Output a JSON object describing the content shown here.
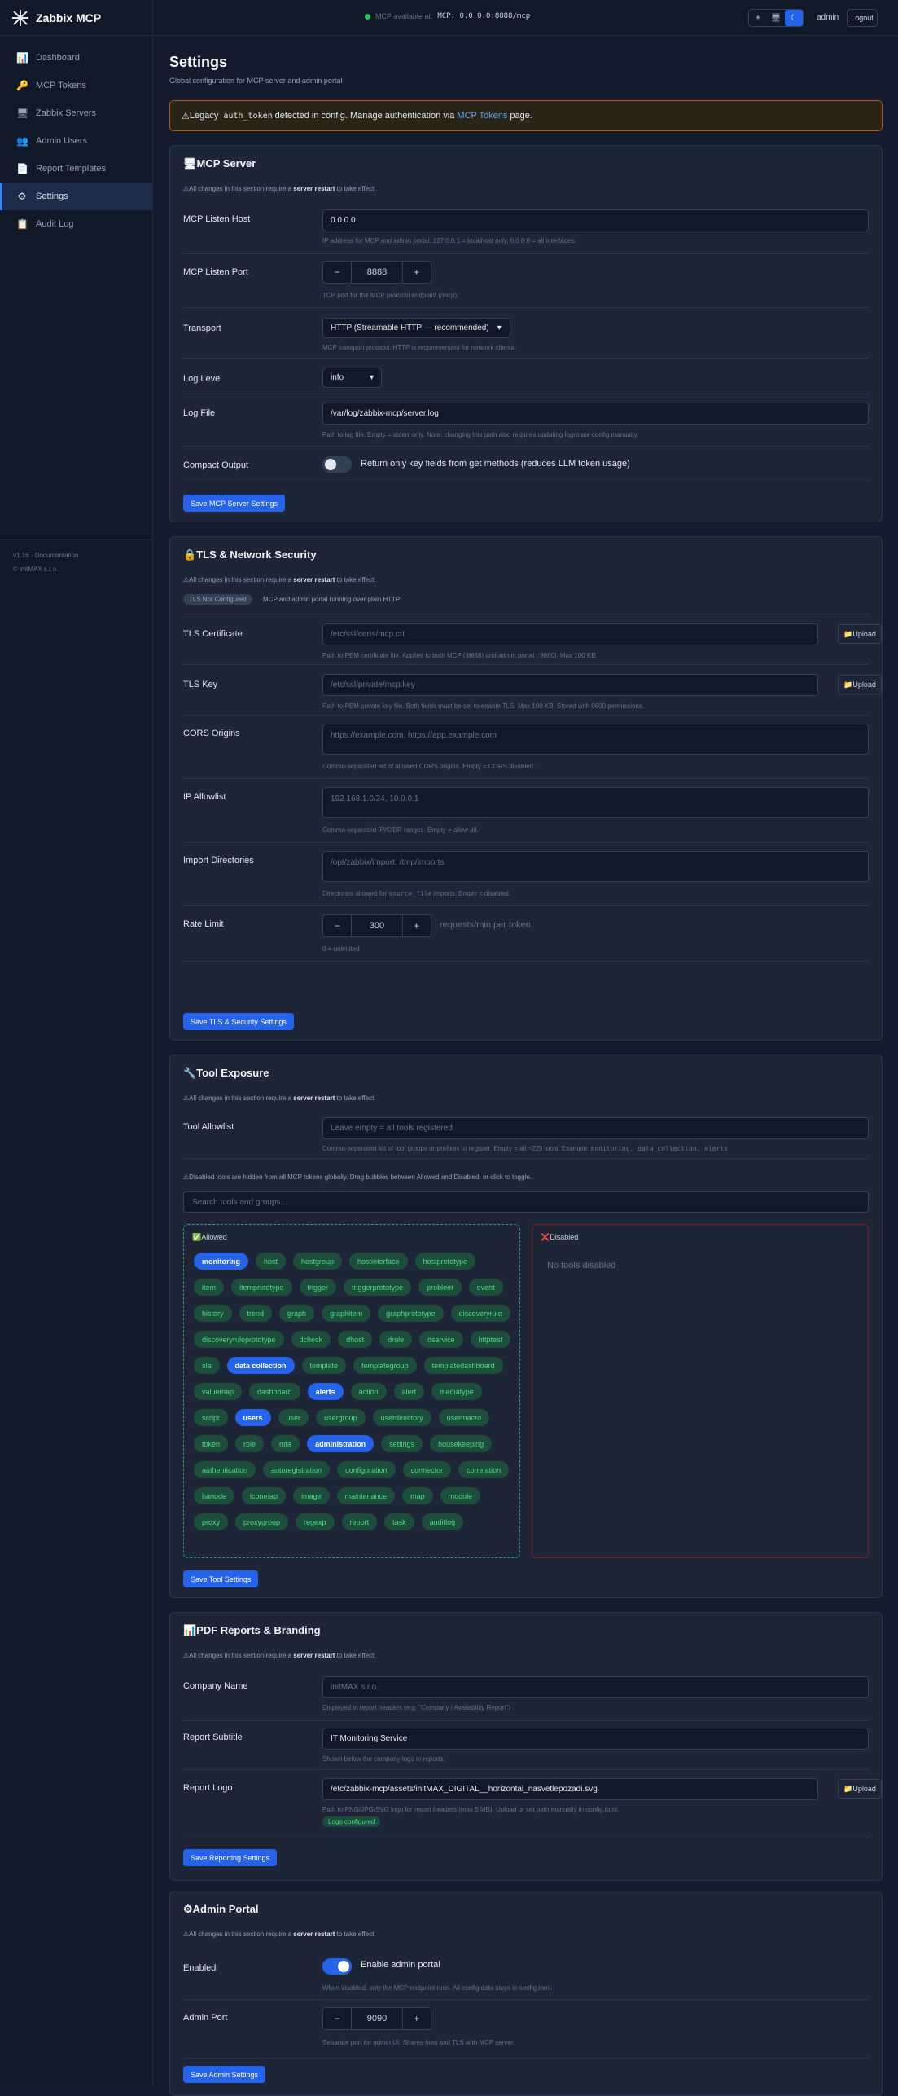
{
  "app": {
    "name": "Zabbix MCP"
  },
  "sidebar": {
    "items": [
      {
        "icon": "📊",
        "label": "Dashboard"
      },
      {
        "icon": "🔑",
        "label": "MCP Tokens"
      },
      {
        "icon": "🖥",
        "label": "Zabbix Servers"
      },
      {
        "icon": "👥",
        "label": "Admin Users"
      },
      {
        "icon": "📄",
        "label": "Report Templates"
      },
      {
        "icon": "⚙",
        "label": "Settings"
      },
      {
        "icon": "📋",
        "label": "Audit Log"
      }
    ],
    "version": "v1.16",
    "docs_label": "Documentation",
    "copyright": "© initMAX s.r.o."
  },
  "topbar": {
    "avail_label": "MCP available at:",
    "endpoint": "MCP: 0.0.0.0:8888/mcp",
    "user": "admin",
    "logout_label": "Logout",
    "theme_icons": [
      "☀",
      "🖥",
      "☾"
    ]
  },
  "page": {
    "title": "Settings",
    "subtitle": "Global configuration for MCP server and admin portal"
  },
  "warning": {
    "icon": "⚠",
    "pre": "Legacy",
    "code": "auth_token",
    "mid": "detected in config. Manage authentication via",
    "link": "MCP Tokens",
    "post": "page."
  },
  "restart_note": {
    "icon": "⚠",
    "pre": "All changes in this section require a",
    "bold": "server restart",
    "post": "to take effect."
  },
  "mcp": {
    "title": "🖥MCP Server",
    "host_label": "MCP Listen Host",
    "host_value": "0.0.0.0",
    "host_help": "IP address for MCP and admin portal. 127.0.0.1 = localhost only, 0.0.0.0 = all interfaces.",
    "port_label": "MCP Listen Port",
    "port_value": "8888",
    "port_help": "TCP port for the MCP protocol endpoint (/mcp).",
    "transport_label": "Transport",
    "transport_value": "HTTP (Streamable HTTP — recommended)",
    "transport_help": "MCP transport protocol. HTTP is recommended for network clients.",
    "loglevel_label": "Log Level",
    "loglevel_value": "info",
    "logfile_label": "Log File",
    "logfile_value": "/var/log/zabbix-mcp/server.log",
    "logfile_help": "Path to log file. Empty = stderr only. Note: changing this path also requires updating logrotate config manually.",
    "compact_label": "Compact Output",
    "compact_text": "Return only key fields from get methods (reduces LLM token usage)",
    "compact_on": false,
    "save_label": "Save MCP Server Settings"
  },
  "tls": {
    "title": "🔒TLS & Network Security",
    "status_badge": "TLS Not Configured",
    "status_text": "MCP and admin portal running over plain HTTP",
    "cert_label": "TLS Certificate",
    "cert_placeholder": "/etc/ssl/certs/mcp.crt",
    "cert_help": "Path to PEM certificate file. Applies to both MCP (:8888) and admin portal (:9090). Max 100 KB.",
    "key_label": "TLS Key",
    "key_placeholder": "/etc/ssl/private/mcp.key",
    "key_help": "Path to PEM private key file. Both fields must be set to enable TLS. Max 100 KB. Stored with 0600 permissions.",
    "upload_label": "📁Upload",
    "cors_label": "CORS Origins",
    "cors_placeholder": "https://example.com, https://app.example.com",
    "cors_help": "Comma-separated list of allowed CORS origins. Empty = CORS disabled.",
    "ip_label": "IP Allowlist",
    "ip_placeholder": "192.168.1.0/24, 10.0.0.1",
    "ip_help": "Comma-separated IP/CIDR ranges. Empty = allow all.",
    "import_label": "Import Directories",
    "import_placeholder": "/opt/zabbix/import, /tmp/imports",
    "import_help_pre": "Directories allowed for",
    "import_help_code": "source_file",
    "import_help_post": "imports. Empty = disabled.",
    "rate_label": "Rate Limit",
    "rate_value": "300",
    "rate_unit": "requests/min per token",
    "rate_help": "0 = unlimited",
    "save_label": "Save TLS & Security Settings"
  },
  "tools": {
    "title": "🔧Tool Exposure",
    "allowlist_label": "Tool Allowlist",
    "allowlist_placeholder": "Leave empty = all tools registered",
    "allowlist_help_pre": "Comma-separated list of tool groups or prefixes to register. Empty = all ~225 tools. Example:",
    "allowlist_help_code": "monitoring, data_collection, alerts",
    "disabled_note": "⚠Disabled tools are hidden from all MCP tokens globally. Drag bubbles between Allowed and Disabled, or click to toggle.",
    "search_placeholder": "Search tools and groups...",
    "allowed_title": "✅Allowed",
    "disabled_title": "❌Disabled",
    "no_disabled": "No tools disabled",
    "chips": [
      {
        "t": "monitoring",
        "g": true
      },
      {
        "t": "host"
      },
      {
        "t": "hostgroup"
      },
      {
        "t": "hostinterface"
      },
      {
        "t": "hostprototype"
      },
      {
        "t": "item"
      },
      {
        "t": "itemprototype"
      },
      {
        "t": "trigger"
      },
      {
        "t": "triggerprototype"
      },
      {
        "t": "problem"
      },
      {
        "t": "event"
      },
      {
        "t": "history"
      },
      {
        "t": "trend"
      },
      {
        "t": "graph"
      },
      {
        "t": "graphitem"
      },
      {
        "t": "graphprototype"
      },
      {
        "t": "discoveryrule"
      },
      {
        "t": "discoveryruleprototype"
      },
      {
        "t": "dcheck"
      },
      {
        "t": "dhost"
      },
      {
        "t": "drule"
      },
      {
        "t": "dservice"
      },
      {
        "t": "httptest"
      },
      {
        "t": "sla"
      },
      {
        "t": "data collection",
        "g": true
      },
      {
        "t": "template"
      },
      {
        "t": "templategroup"
      },
      {
        "t": "templatedashboard"
      },
      {
        "t": "valuemap"
      },
      {
        "t": "dashboard"
      },
      {
        "t": "alerts",
        "g": true
      },
      {
        "t": "action"
      },
      {
        "t": "alert"
      },
      {
        "t": "mediatype"
      },
      {
        "t": "script"
      },
      {
        "t": "users",
        "g": true
      },
      {
        "t": "user"
      },
      {
        "t": "usergroup"
      },
      {
        "t": "userdirectory"
      },
      {
        "t": "usermacro"
      },
      {
        "t": "token"
      },
      {
        "t": "role"
      },
      {
        "t": "mfa"
      },
      {
        "t": "administration",
        "g": true
      },
      {
        "t": "settings"
      },
      {
        "t": "housekeeping"
      },
      {
        "t": "authentication"
      },
      {
        "t": "autoregistration"
      },
      {
        "t": "configuration"
      },
      {
        "t": "connector"
      },
      {
        "t": "correlation"
      },
      {
        "t": "hanode"
      },
      {
        "t": "iconmap"
      },
      {
        "t": "image"
      },
      {
        "t": "maintenance"
      },
      {
        "t": "map"
      },
      {
        "t": "module"
      },
      {
        "t": "proxy"
      },
      {
        "t": "proxygroup"
      },
      {
        "t": "regexp"
      },
      {
        "t": "report"
      },
      {
        "t": "task"
      },
      {
        "t": "auditlog"
      }
    ],
    "save_label": "Save Tool Settings"
  },
  "pdf": {
    "title": "📊PDF Reports & Branding",
    "company_label": "Company Name",
    "company_placeholder": "initMAX s.r.o.",
    "company_help": "Displayed in report headers (e.g. \"Company / Availability Report\")",
    "subtitle_label": "Report Subtitle",
    "subtitle_value": "IT Monitoring Service",
    "subtitle_help": "Shown below the company logo in reports.",
    "logo_label": "Report Logo",
    "logo_value": "/etc/zabbix-mcp/assets/initMAX_DIGITAL__horizontal_nasvetlepozadi.svg",
    "logo_help": "Path to PNG/JPG/SVG logo for report headers (max 5 MB). Upload or set path manually in config.toml.",
    "logo_badge": "Logo configured",
    "upload_label": "📁Upload",
    "save_label": "Save Reporting Settings"
  },
  "admin": {
    "title": "⚙Admin Portal",
    "enabled_label": "Enabled",
    "enabled_text": "Enable admin portal",
    "enabled_on": true,
    "enabled_help": "When disabled, only the MCP endpoint runs. All config data stays in config.toml.",
    "port_label": "Admin Port",
    "port_value": "9090",
    "port_help": "Separate port for admin UI. Shares host and TLS with MCP server.",
    "save_label": "Save Admin Settings"
  }
}
